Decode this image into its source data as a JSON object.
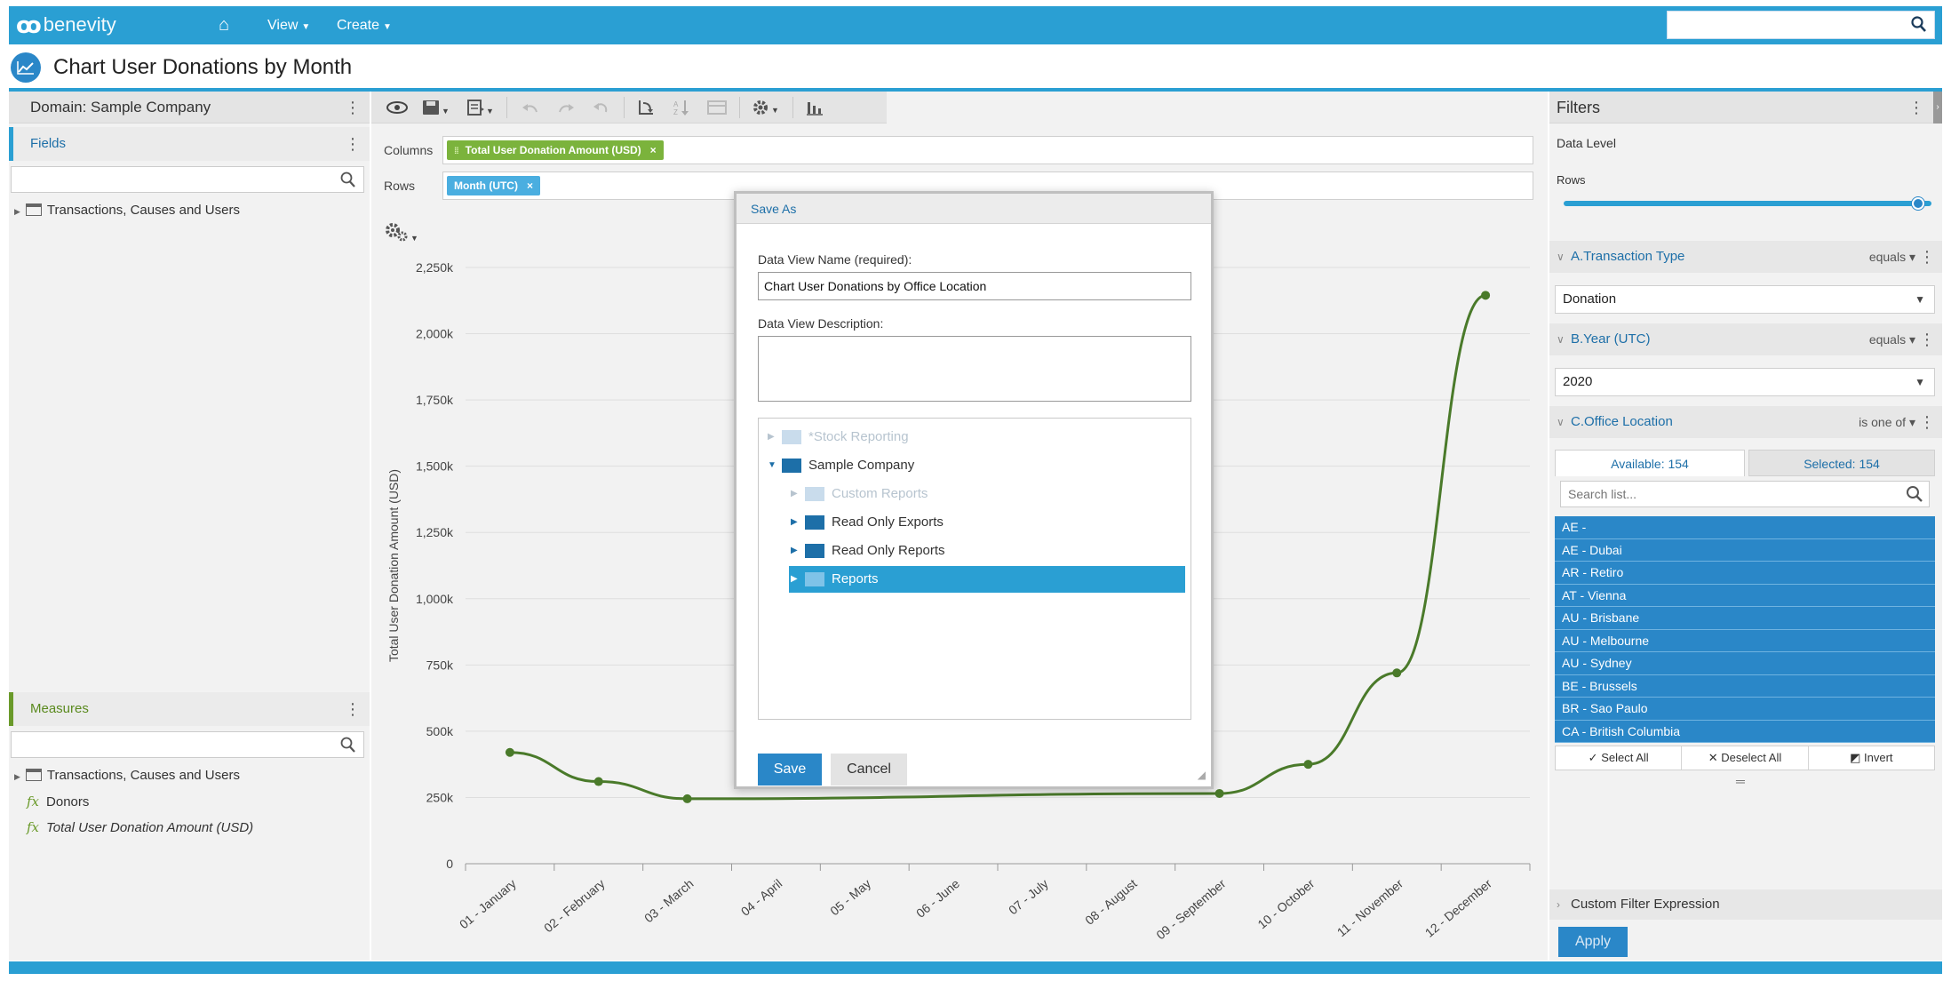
{
  "nav": {
    "logo_text": "benevity",
    "view_label": "View",
    "create_label": "Create",
    "search_value": ""
  },
  "page": {
    "title": "Chart User Donations by Month"
  },
  "left": {
    "domain_label": "Domain: Sample Company",
    "fields_label": "Fields",
    "fields_tree": [
      "Transactions, Causes and Users"
    ],
    "measures_label": "Measures",
    "measures_tree": [
      "Transactions, Causes and Users"
    ],
    "measures_items": [
      "Donors",
      "Total User Donation Amount (USD)"
    ]
  },
  "center": {
    "columns_label": "Columns",
    "rows_label": "Rows",
    "column_pill": "Total User Donation Amount (USD)",
    "row_pill": "Month (UTC)"
  },
  "chart_data": {
    "type": "line",
    "categories": [
      "01 - January",
      "02 - February",
      "03 - March",
      "04 - April",
      "05 - May",
      "06 - June",
      "07 - July",
      "08 - August",
      "09 - September",
      "10 - October",
      "11 - November",
      "12 - December"
    ],
    "series": [
      {
        "values": [
          420000,
          310000,
          245000,
          null,
          null,
          null,
          null,
          null,
          265000,
          375000,
          720000,
          2145000
        ]
      }
    ],
    "ylabel": "Total User Donation Amount (USD)",
    "yticks": [
      "0",
      "250k",
      "500k",
      "750k",
      "1,000k",
      "1,250k",
      "1,500k",
      "1,750k",
      "2,000k",
      "2,250k"
    ],
    "ylim": [
      0,
      2250000
    ],
    "grid": true,
    "color": "#4a7a2a"
  },
  "dialog": {
    "title": "Save As",
    "name_label": "Data View Name (required):",
    "name_value": "Chart User Donations by Office Location",
    "desc_label": "Data View Description:",
    "desc_value": "",
    "folders": {
      "stock": "*Stock Reporting",
      "sample": "Sample Company",
      "custom": "Custom Reports",
      "exports": "Read Only Exports",
      "ro_reports": "Read Only Reports",
      "reports": "Reports"
    },
    "save_label": "Save",
    "cancel_label": "Cancel"
  },
  "filters": {
    "title": "Filters",
    "data_level": "Data Level",
    "rows_label": "Rows",
    "f1": {
      "name": "A.Transaction Type",
      "op": "equals",
      "value": "Donation"
    },
    "f2": {
      "name": "B.Year (UTC)",
      "op": "equals",
      "value": "2020"
    },
    "f3": {
      "name": "C.Office Location",
      "op": "is one of",
      "available": "Available: 154",
      "selected": "Selected: 154",
      "search_placeholder": "Search list...",
      "items": [
        "AE -",
        "AE - Dubai",
        "AR - Retiro",
        "AT - Vienna",
        "AU - Brisbane",
        "AU - Melbourne",
        "AU - Sydney",
        "BE - Brussels",
        "BR - Sao Paulo",
        "CA - British Columbia"
      ],
      "select_all": "Select All",
      "deselect_all": "Deselect All",
      "invert": "Invert"
    },
    "custom_expression": "Custom Filter Expression",
    "apply_label": "Apply"
  },
  "colors": {
    "brand": "#2a9fd3",
    "accent": "#2a87c8",
    "pill_green": "#7bb33c",
    "pill_blue": "#4aaee0"
  }
}
